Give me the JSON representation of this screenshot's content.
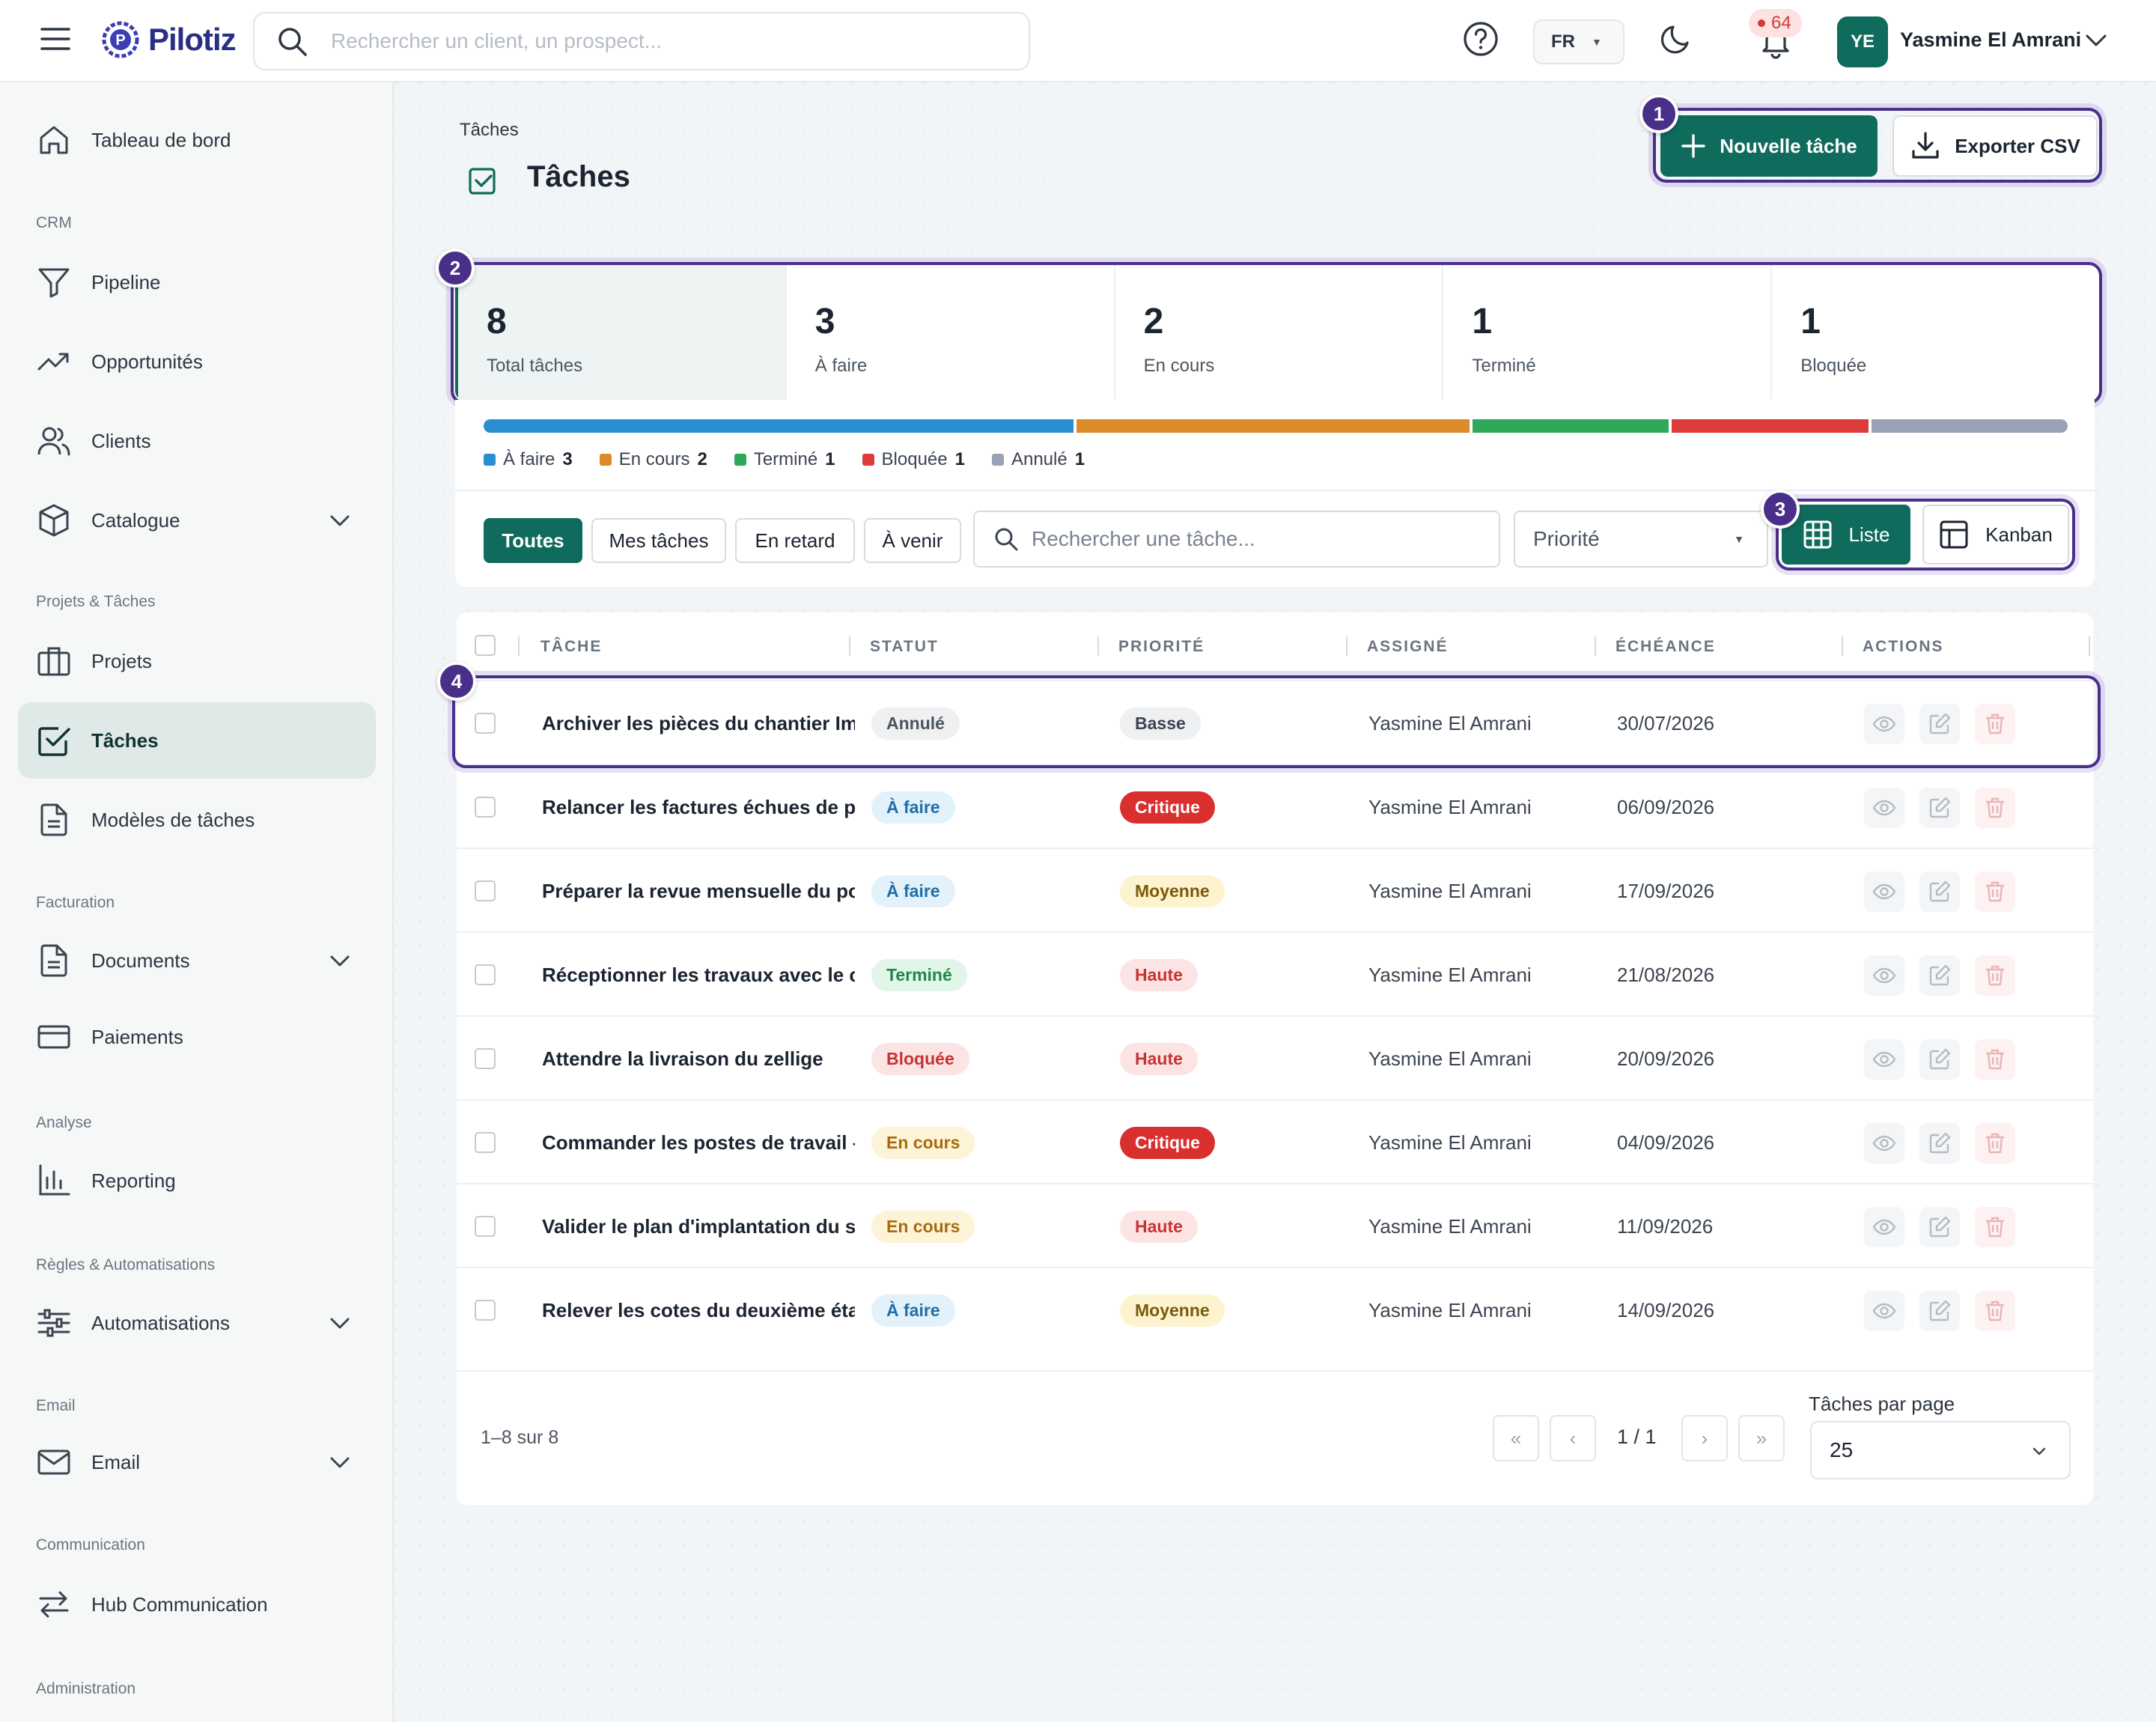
{
  "header": {
    "brand": "Pilotiz",
    "search_placeholder": "Rechercher un client, un prospect...",
    "language": "FR",
    "notifications": "64",
    "user_initials": "YE",
    "user_name": "Yasmine El Amrani"
  },
  "sidebar": {
    "dashboard": "Tableau de bord",
    "sec_crm": "CRM",
    "pipeline": "Pipeline",
    "opportunities": "Opportunités",
    "clients": "Clients",
    "catalogue": "Catalogue",
    "sec_projects": "Projets & Tâches",
    "projects": "Projets",
    "tasks": "Tâches",
    "templates": "Modèles de tâches",
    "sec_billing": "Facturation",
    "documents": "Documents",
    "payments": "Paiements",
    "sec_analysis": "Analyse",
    "reporting": "Reporting",
    "sec_rules": "Règles & Automatisations",
    "automations": "Automatisations",
    "sec_email": "Email",
    "email": "Email",
    "sec_comm": "Communication",
    "hub": "Hub Communication",
    "sec_admin": "Administration"
  },
  "page": {
    "breadcrumb": "Tâches",
    "title": "Tâches",
    "new_task": "Nouvelle tâche",
    "export_csv": "Exporter CSV"
  },
  "callouts": [
    "1",
    "2",
    "3",
    "4"
  ],
  "stats": [
    {
      "value": "8",
      "label": "Total tâches"
    },
    {
      "value": "3",
      "label": "À faire"
    },
    {
      "value": "2",
      "label": "En cours"
    },
    {
      "value": "1",
      "label": "Terminé"
    },
    {
      "value": "1",
      "label": "Bloquée"
    }
  ],
  "distribution": [
    {
      "label": "À faire",
      "count": "3",
      "color": "#2a8fd0"
    },
    {
      "label": "En cours",
      "count": "2",
      "color": "#dd8a2a"
    },
    {
      "label": "Terminé",
      "count": "1",
      "color": "#2fa85a"
    },
    {
      "label": "Bloquée",
      "count": "1",
      "color": "#de3b3b"
    },
    {
      "label": "Annulé",
      "count": "1",
      "color": "#9aa3b5"
    }
  ],
  "filters": {
    "all": "Toutes",
    "mine": "Mes tâches",
    "late": "En retard",
    "upcoming": "À venir",
    "search_placeholder": "Rechercher une tâche...",
    "priority": "Priorité",
    "view_list": "Liste",
    "view_kanban": "Kanban"
  },
  "table": {
    "columns": {
      "task": "TÂCHE",
      "status": "STATUT",
      "priority": "PRIORITÉ",
      "assignee": "ASSIGNÉ",
      "due": "ÉCHÉANCE",
      "actions": "ACTIONS"
    },
    "rows": [
      {
        "task": "Archiver les pièces du chantier Imi",
        "status": "Annulé",
        "priority": "Basse",
        "assignee": "Yasmine El Amrani",
        "due": "30/07/2026"
      },
      {
        "task": "Relancer les factures échues de pl",
        "status": "À faire",
        "priority": "Critique",
        "assignee": "Yasmine El Amrani",
        "due": "06/09/2026"
      },
      {
        "task": "Préparer la revue mensuelle du po",
        "status": "À faire",
        "priority": "Moyenne",
        "assignee": "Yasmine El Amrani",
        "due": "17/09/2026"
      },
      {
        "task": "Réceptionner les travaux avec le cl",
        "status": "Terminé",
        "priority": "Haute",
        "assignee": "Yasmine El Amrani",
        "due": "21/08/2026"
      },
      {
        "task": "Attendre la livraison du zellige",
        "status": "Bloquée",
        "priority": "Haute",
        "assignee": "Yasmine El Amrani",
        "due": "20/09/2026"
      },
      {
        "task": "Commander les postes de travail –",
        "status": "En cours",
        "priority": "Critique",
        "assignee": "Yasmine El Amrani",
        "due": "04/09/2026"
      },
      {
        "task": "Valider le plan d'implantation du s",
        "status": "En cours",
        "priority": "Haute",
        "assignee": "Yasmine El Amrani",
        "due": "11/09/2026"
      },
      {
        "task": "Relever les cotes du deuxième éta",
        "status": "À faire",
        "priority": "Moyenne",
        "assignee": "Yasmine El Amrani",
        "due": "14/09/2026"
      }
    ]
  },
  "pagination": {
    "range": "1–8 sur 8",
    "first": "«",
    "prev": "‹",
    "page": "1 / 1",
    "next": "›",
    "last": "»",
    "per_page_label": "Tâches par page",
    "per_page": "25"
  },
  "theme": {
    "primary": "#0f6b5c",
    "callout": "#4a2f8a"
  }
}
